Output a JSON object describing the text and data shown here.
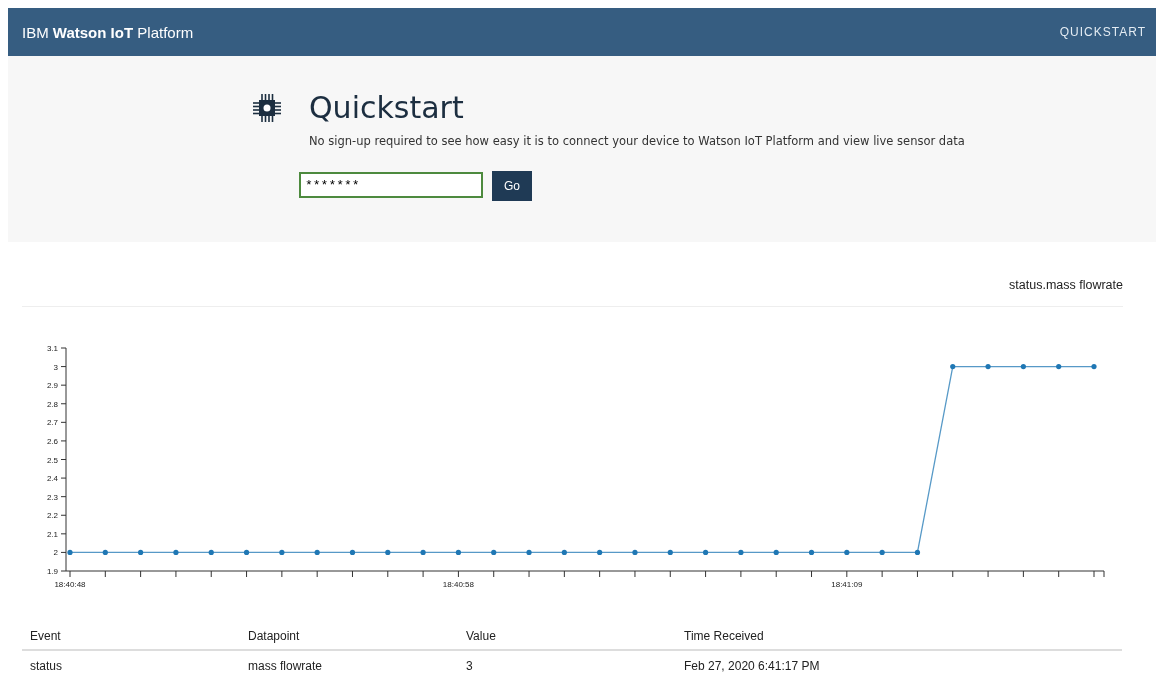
{
  "header": {
    "brand_prefix": "IBM",
    "brand_bold": "Watson IoT",
    "brand_suffix": "Platform",
    "nav_link": "QUICKSTART"
  },
  "hero": {
    "title": "Quickstart",
    "description": "No sign-up required to see how easy it is to connect your device to Watson IoT Platform and view live sensor data",
    "device_field": {
      "value": "*******"
    },
    "go_button": "Go"
  },
  "chart": {
    "chart_data": {
      "type": "line",
      "title": "status.mass flowrate",
      "categories": [
        "18:40:48",
        null,
        null,
        null,
        null,
        null,
        null,
        null,
        null,
        null,
        null,
        "18:40:58",
        null,
        null,
        null,
        null,
        null,
        null,
        null,
        null,
        null,
        null,
        "18:41:09",
        null,
        null,
        null,
        null,
        null,
        null,
        null
      ],
      "series": [
        {
          "color": "#1f77b4",
          "values": [
            2,
            2,
            2,
            2,
            2,
            2,
            2,
            2,
            2,
            2,
            2,
            2,
            2,
            2,
            2,
            2,
            2,
            2,
            2,
            2,
            2,
            2,
            2,
            2,
            2,
            3,
            3,
            3,
            3,
            3
          ]
        }
      ],
      "ylim": [
        1.9,
        3.1
      ],
      "yticks": [
        {
          "value": 1.9,
          "label": "1.9"
        },
        {
          "value": 2.0,
          "label": "2"
        },
        {
          "value": 2.1,
          "label": "2.1"
        },
        {
          "value": 2.2,
          "label": "2.2"
        },
        {
          "value": 2.3,
          "label": "2.3"
        },
        {
          "value": 2.4,
          "label": "2.4"
        },
        {
          "value": 2.5,
          "label": "2.5"
        },
        {
          "value": 2.6,
          "label": "2.6"
        },
        {
          "value": 2.7,
          "label": "2.7"
        },
        {
          "value": 2.8,
          "label": "2.8"
        },
        {
          "value": 2.9,
          "label": "2.9"
        },
        {
          "value": 3.0,
          "label": "3"
        },
        {
          "value": 3.1,
          "label": "3.1"
        }
      ]
    }
  },
  "table": {
    "columns": [
      "Event",
      "Datapoint",
      "Value",
      "Time Received"
    ],
    "rows": [
      [
        "status",
        "mass flowrate",
        "3",
        "Feb 27, 2020 6:41:17 PM"
      ]
    ]
  }
}
